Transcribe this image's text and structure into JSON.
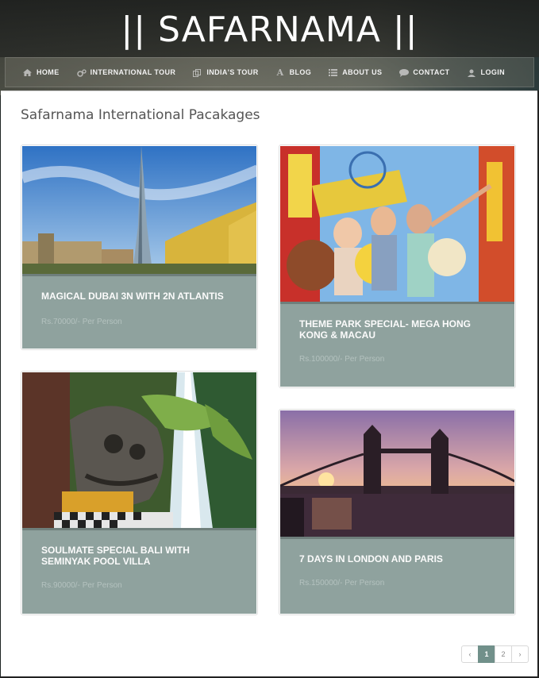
{
  "site": {
    "title": "|| SAFARNAMA ||"
  },
  "nav": {
    "items": [
      {
        "label": "HOME",
        "icon": "home-icon"
      },
      {
        "label": "INTERNATIONAL TOUR",
        "icon": "gears-icon"
      },
      {
        "label": "INDIA'S TOUR",
        "icon": "copy-icon"
      },
      {
        "label": "BLOG",
        "icon": "font-icon"
      },
      {
        "label": "ABOUT US",
        "icon": "list-icon"
      },
      {
        "label": "CONTACT",
        "icon": "comment-icon"
      },
      {
        "label": "LOGIN",
        "icon": "user-icon"
      }
    ]
  },
  "main": {
    "heading": "Safarnama International Pacakages",
    "packages": [
      {
        "title": "MAGICAL DUBAI 3N WITH 2N ATLANTIS",
        "price": "Rs.70000/- Per Person"
      },
      {
        "title": "THEME PARK SPECIAL- MEGA HONG KONG & MACAU",
        "price": "Rs.100000/- Per Person"
      },
      {
        "title": "SOULMATE SPECIAL BALI WITH SEMINYAK POOL VILLA",
        "price": "Rs.90000/- Per Person"
      },
      {
        "title": "7 DAYS IN LONDON AND PARIS",
        "price": "Rs.150000/- Per Person"
      }
    ]
  },
  "pagination": {
    "prev": "‹",
    "pages": [
      "1",
      "2"
    ],
    "next": "›",
    "current": "1"
  },
  "colors": {
    "card_info": "#8fa29e",
    "accent": "#71908a"
  }
}
